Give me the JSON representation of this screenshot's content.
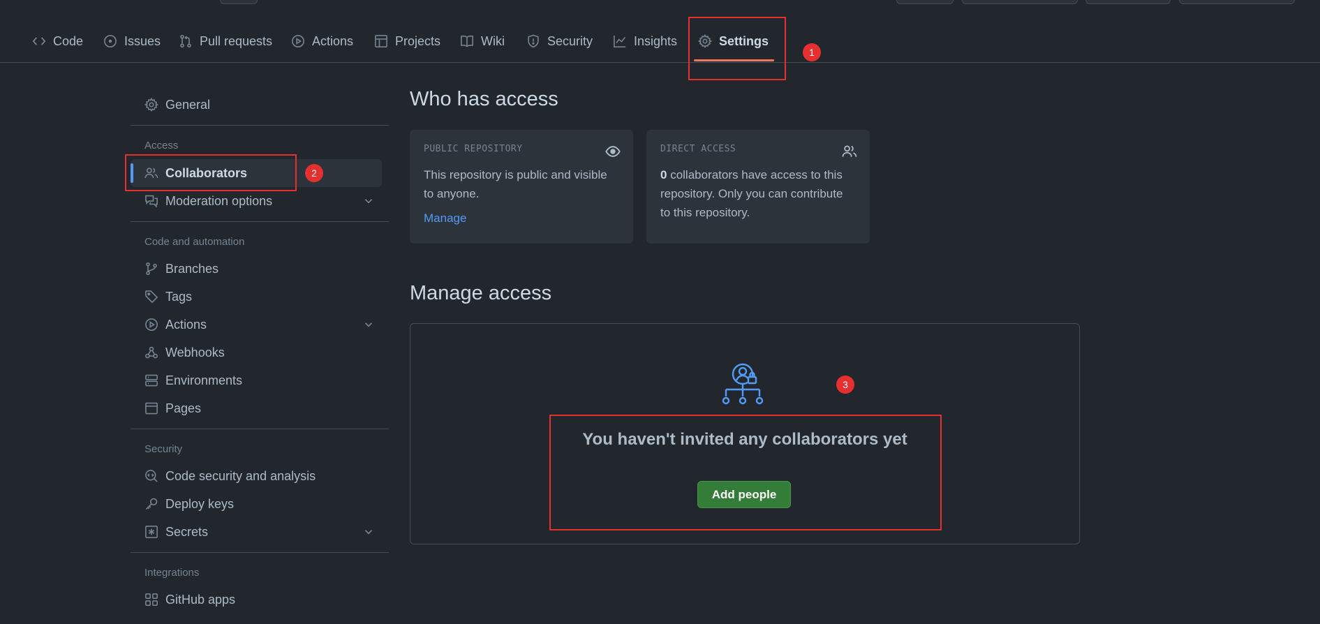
{
  "nav": {
    "tabs": [
      {
        "label": "Code",
        "icon": "code-icon"
      },
      {
        "label": "Issues",
        "icon": "issue-opened-icon"
      },
      {
        "label": "Pull requests",
        "icon": "git-pull-request-icon"
      },
      {
        "label": "Actions",
        "icon": "play-icon"
      },
      {
        "label": "Projects",
        "icon": "table-icon"
      },
      {
        "label": "Wiki",
        "icon": "book-icon"
      },
      {
        "label": "Security",
        "icon": "shield-icon"
      },
      {
        "label": "Insights",
        "icon": "graph-icon"
      },
      {
        "label": "Settings",
        "icon": "gear-icon"
      }
    ],
    "active": "Settings"
  },
  "sidebar": {
    "general": "General",
    "access_heading": "Access",
    "collaborators": "Collaborators",
    "moderation": "Moderation options",
    "code_heading": "Code and automation",
    "branches": "Branches",
    "tags": "Tags",
    "actions": "Actions",
    "webhooks": "Webhooks",
    "environments": "Environments",
    "pages": "Pages",
    "security_heading": "Security",
    "code_security": "Code security and analysis",
    "deploy_keys": "Deploy keys",
    "secrets": "Secrets",
    "integrations_heading": "Integrations",
    "github_apps": "GitHub apps"
  },
  "main": {
    "who_title": "Who has access",
    "public_card": {
      "label": "PUBLIC REPOSITORY",
      "text": "This repository is public and visible to anyone.",
      "link": "Manage"
    },
    "direct_card": {
      "label": "DIRECT ACCESS",
      "count": "0",
      "text": " collaborators have access to this repository. Only you can contribute to this repository."
    },
    "manage_title": "Manage access",
    "empty_title": "You haven't invited any collaborators yet",
    "add_button": "Add people"
  },
  "annotations": {
    "badge1": "1",
    "badge2": "2",
    "badge3": "3"
  },
  "colors": {
    "background": "#22272e",
    "accent": "#539bf5",
    "annotation": "#e5302f",
    "button": "#347d39",
    "tab_underline": "#ec775c"
  }
}
